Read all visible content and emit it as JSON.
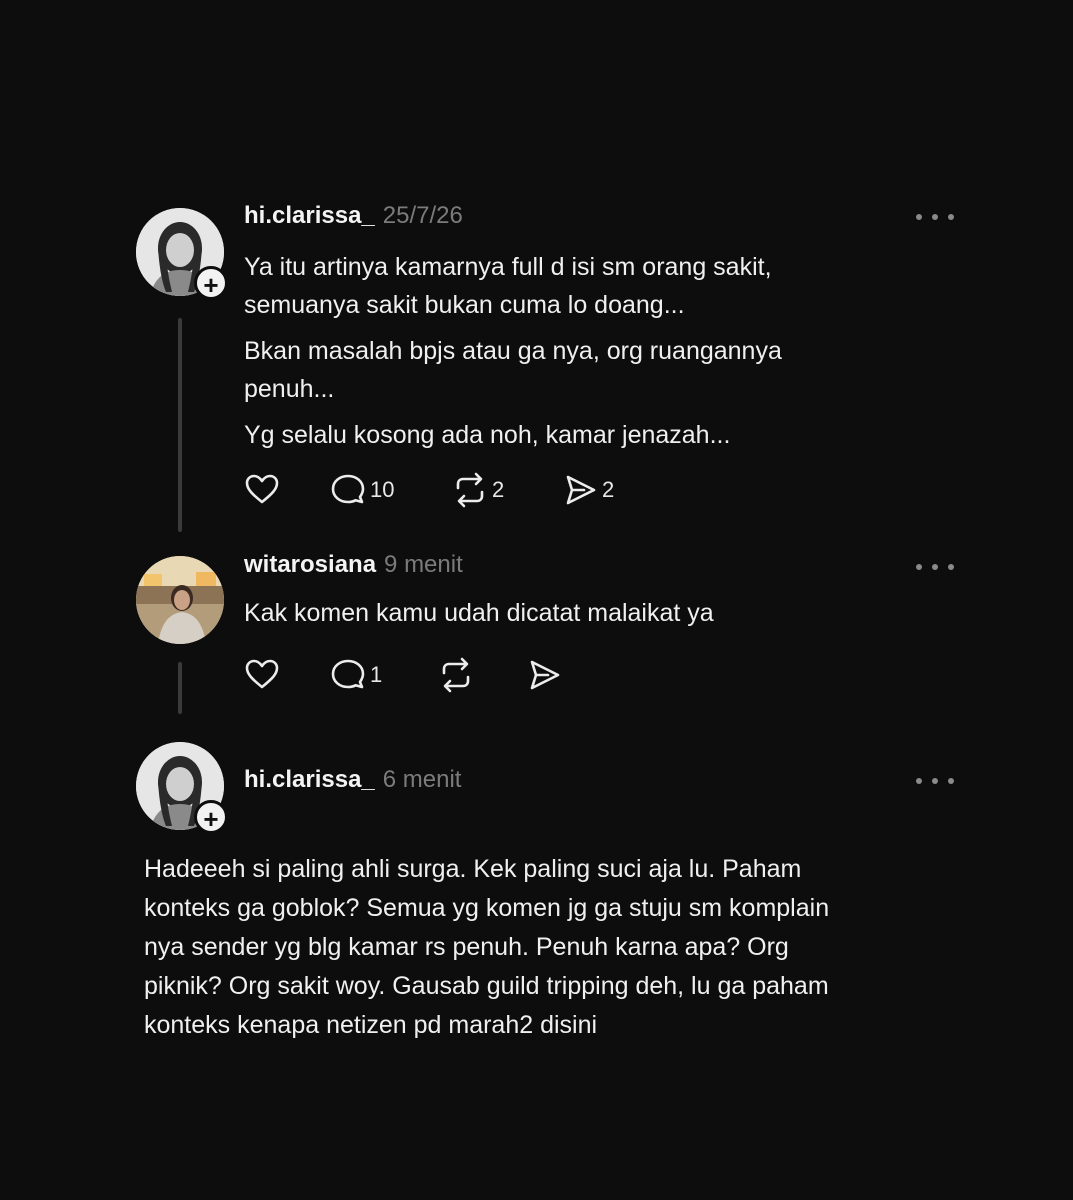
{
  "posts": [
    {
      "username": "hi.clarissa_",
      "time": "25/7/26",
      "paragraphs": [
        "Ya itu artinya kamarnya full d isi sm orang sakit,\nsemuanya sakit bukan cuma lo doang...",
        "Bkan masalah bpjs atau ga nya, org ruangannya\npenuh...",
        "Yg selalu kosong ada noh, kamar jenazah..."
      ],
      "likes": "",
      "replies": "10",
      "reposts": "2",
      "shares": "2"
    },
    {
      "username": "witarosiana",
      "time": "9 menit",
      "text": "Kak komen kamu udah dicatat malaikat ya",
      "replies": "1"
    },
    {
      "username": "hi.clarissa_",
      "time": "6 menit",
      "text": "Hadeeeh si paling ahli surga. Kek paling suci aja lu. Paham\nkonteks ga goblok? Semua yg komen jg ga stuju sm komplain\nnya sender yg blg kamar rs penuh. Penuh karna apa? Org\npiknik? Org sakit woy. Gausab guild tripping deh, lu ga paham\nkonteks kenapa netizen pd marah2 disini"
    }
  ],
  "icons": [
    "heart-icon",
    "comment-icon",
    "repost-icon",
    "share-icon",
    "more-icon",
    "plus-icon"
  ],
  "colors": {
    "background": "#0d0d0d",
    "text": "#f2f2f2",
    "muted": "#7b7b7b",
    "thread_line": "#3a3a3a"
  }
}
